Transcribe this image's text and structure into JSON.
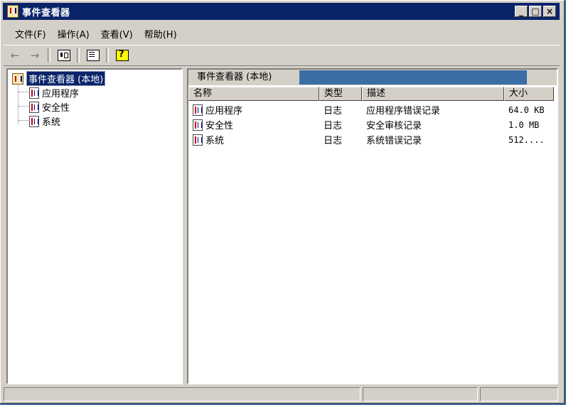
{
  "window": {
    "title": "事件查看器",
    "buttons": [
      "_",
      "□",
      "×"
    ]
  },
  "menu": {
    "items": [
      "文件(F)",
      "操作(A)",
      "查看(V)",
      "帮助(H)"
    ]
  },
  "toolbar": {
    "buttons": [
      "back-arrow-icon",
      "forward-arrow-icon",
      "show-hide-pane-icon",
      "export-list-icon",
      "help-icon"
    ]
  },
  "tree": {
    "root": "事件查看器 (本地)",
    "children": [
      "应用程序",
      "安全性",
      "系统"
    ]
  },
  "list": {
    "title": "事件查看器 (本地)",
    "columns": [
      "名称",
      "类型",
      "描述",
      "大小"
    ],
    "rows": [
      {
        "name": "应用程序",
        "type": "日志",
        "desc": "应用程序错误记录",
        "size": "64.0 KB"
      },
      {
        "name": "安全性",
        "type": "日志",
        "desc": "安全审核记录",
        "size": "1.0 MB"
      },
      {
        "name": "系统",
        "type": "日志",
        "desc": "系统错误记录",
        "size": "512...."
      }
    ]
  }
}
